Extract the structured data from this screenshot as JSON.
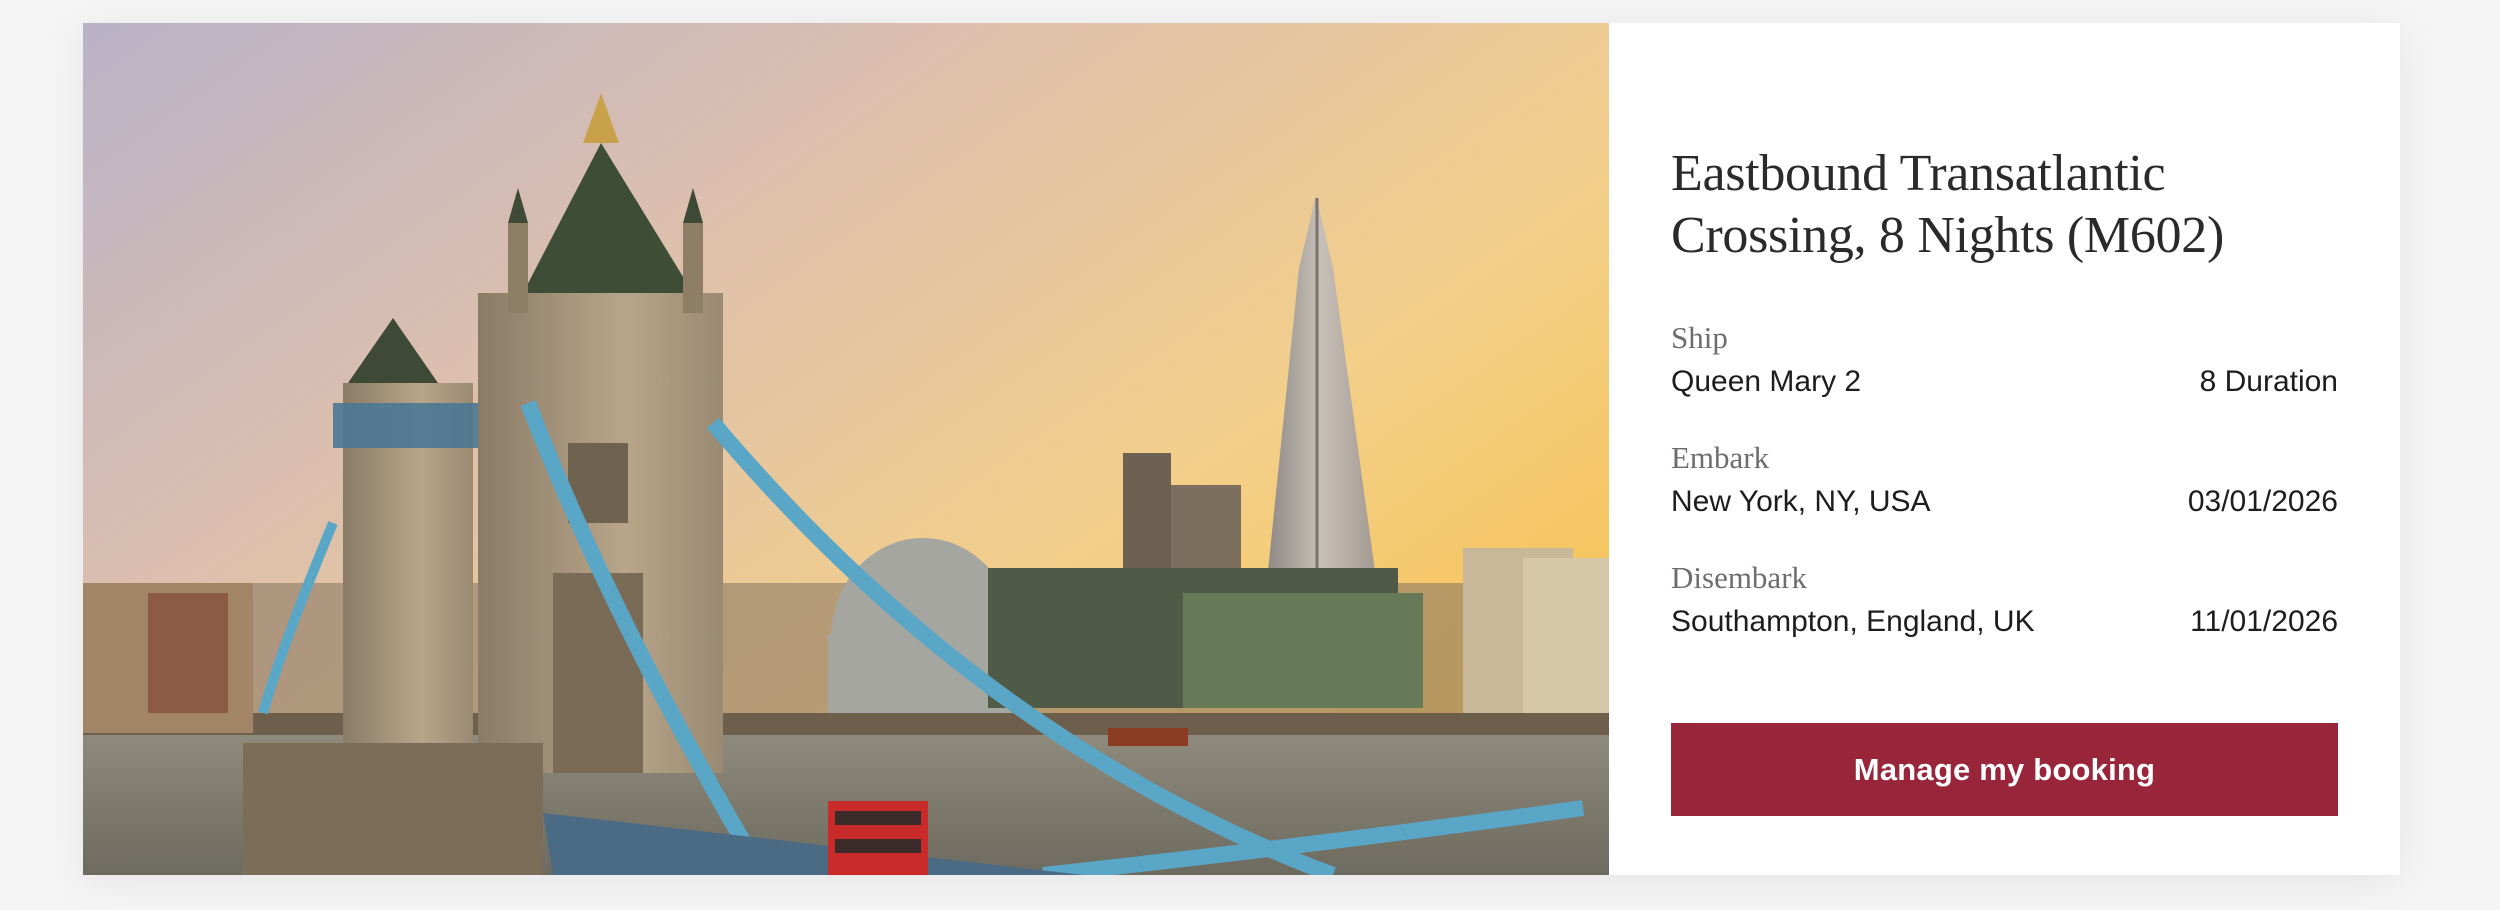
{
  "hero": {
    "icon": "tower-bridge-london-photo"
  },
  "cruise": {
    "title": "Eastbound Transatlantic Crossing, 8 Nights (M602)"
  },
  "ship": {
    "label": "Ship",
    "value": "Queen Mary 2",
    "duration": "8 Duration"
  },
  "embark": {
    "label": "Embark",
    "value": "New York, NY, USA",
    "date": "03/01/2026"
  },
  "disembark": {
    "label": "Disembark",
    "value": "Southampton, England, UK",
    "date": "11/01/2026"
  },
  "actions": {
    "manage_label": "Manage my booking",
    "button_color": "#98253a"
  }
}
